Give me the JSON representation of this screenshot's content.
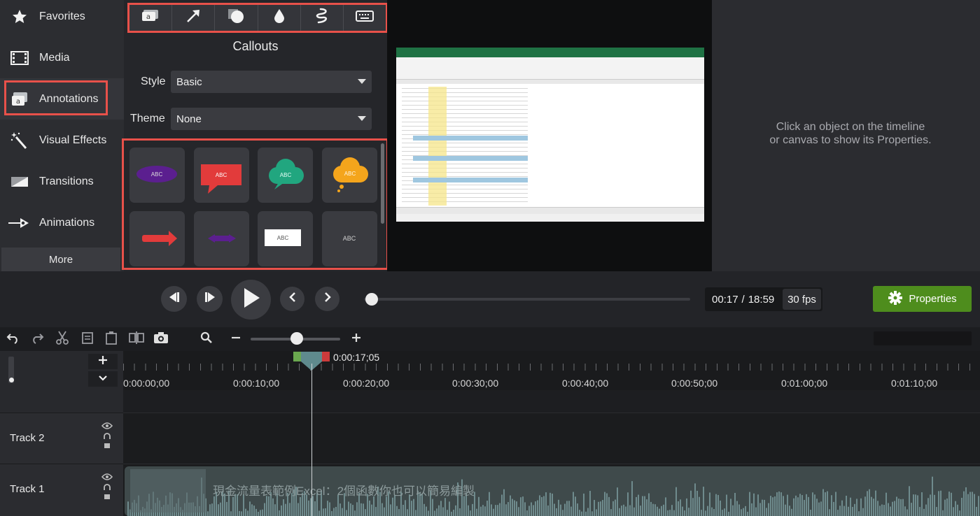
{
  "sidebar": {
    "items": [
      {
        "label": "Favorites",
        "icon": "star-icon"
      },
      {
        "label": "Media",
        "icon": "film-icon"
      },
      {
        "label": "Annotations",
        "icon": "annotation-icon"
      },
      {
        "label": "Visual Effects",
        "icon": "magic-wand-icon"
      },
      {
        "label": "Transitions",
        "icon": "transition-icon"
      },
      {
        "label": "Animations",
        "icon": "animation-arrow-icon"
      }
    ],
    "more_label": "More",
    "active": "Annotations"
  },
  "panel": {
    "tools": [
      "callout-tool-icon",
      "arrow-tool-icon",
      "shape-tool-icon",
      "blur-tool-icon",
      "sketch-motion-icon",
      "keystroke-icon"
    ],
    "title": "Callouts",
    "style_label": "Style",
    "style_value": "Basic",
    "theme_label": "Theme",
    "theme_value": "None",
    "callouts": [
      {
        "text": "ABC",
        "shape": "oval",
        "color": "#5b1f8f"
      },
      {
        "text": "ABC",
        "shape": "speech",
        "color": "#e23b3b"
      },
      {
        "text": "ABC",
        "shape": "cloud",
        "color": "#21a67f"
      },
      {
        "text": "ABC",
        "shape": "thought",
        "color": "#f4a51c"
      },
      {
        "text": "",
        "shape": "arrow",
        "color": "#e23b3b"
      },
      {
        "text": "",
        "shape": "double-arrow",
        "color": "#5b1f8f"
      },
      {
        "text": "ABC",
        "shape": "rectangle",
        "color": "#ffffff"
      },
      {
        "text": "ABC",
        "shape": "text-only",
        "color": "#cfcfcf"
      }
    ]
  },
  "properties": {
    "hint_line1": "Click an object on the timeline",
    "hint_line2": "or canvas to show its Properties.",
    "button_label": "Properties"
  },
  "playback": {
    "current_time": "00:17",
    "separator": "/",
    "total_time": "18:59",
    "fps": "30 fps",
    "progress": 0.015
  },
  "timeline": {
    "playhead_time": "0:00:17;05",
    "ruler": [
      "0:00:00;00",
      "0:00:10;00",
      "0:00:20;00",
      "0:00:30;00",
      "0:00:40;00",
      "0:00:50;00",
      "0:01:00;00",
      "0:01:10;00"
    ],
    "tracks": [
      {
        "name": "Track 2"
      },
      {
        "name": "Track 1",
        "clip_title": "現金流量表範例Excel：2個函數你也可以簡易編製"
      }
    ]
  }
}
